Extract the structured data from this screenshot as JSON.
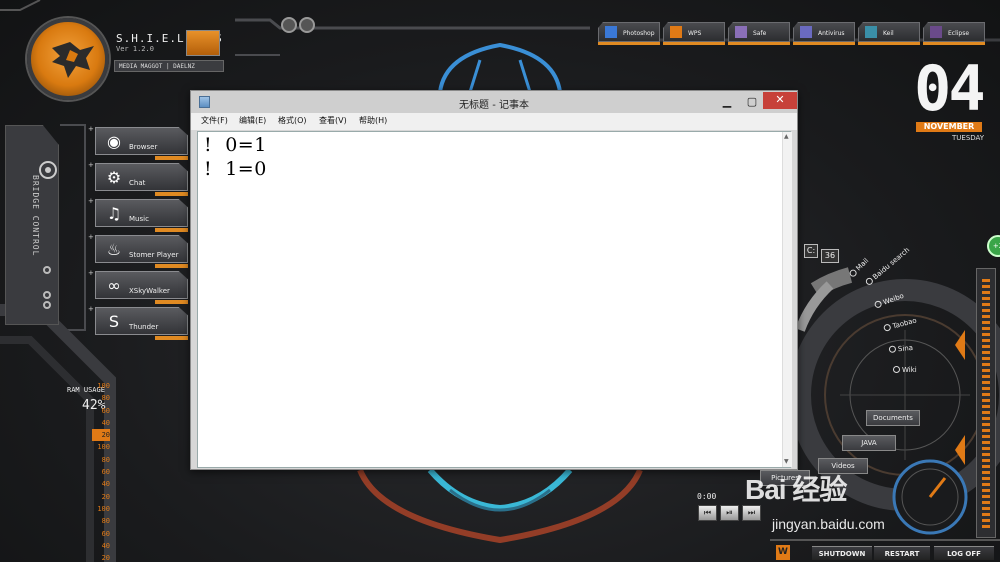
{
  "os_panel": {
    "title": "S.H.I.E.L.D OS",
    "version": "Ver 1.2.0",
    "credit": "MEDIA MAGGOT | DAELNZ"
  },
  "dock": {
    "items": [
      {
        "label": "Photoshop",
        "icon": "photoshop-icon",
        "color": "#3a78d6"
      },
      {
        "label": "WPS",
        "icon": "wps-icon",
        "color": "#e07a16"
      },
      {
        "label": "Safe",
        "icon": "safe-icon",
        "color": "#8a6fb8"
      },
      {
        "label": "Antivirus",
        "icon": "antivirus-icon",
        "color": "#6a6ac0"
      },
      {
        "label": "Keil",
        "icon": "keil-icon",
        "color": "#3a8fa8"
      },
      {
        "label": "Eclipse",
        "icon": "eclipse-icon",
        "color": "#6a4a8a"
      }
    ]
  },
  "clock": {
    "day": "04",
    "month": "NOVEMBER",
    "weekday": "TUESDAY"
  },
  "launcher": {
    "items": [
      {
        "label": "Browser",
        "icon": "chrome-icon",
        "glyph": "◉"
      },
      {
        "label": "Chat",
        "icon": "steam-icon",
        "glyph": "⚙"
      },
      {
        "label": "Music",
        "icon": "music-note-icon",
        "glyph": "♫"
      },
      {
        "label": "Stomer Player",
        "icon": "fire-icon",
        "glyph": "♨"
      },
      {
        "label": "XSkyWalker",
        "icon": "infinity-icon",
        "glyph": "∞"
      },
      {
        "label": "Thunder",
        "icon": "skype-icon",
        "glyph": "S"
      }
    ]
  },
  "bridge_control": "BRIDGE CONTROL",
  "ram": {
    "label": "RAM USAGE",
    "value": "42%",
    "ticks": [
      "100",
      "80",
      "60",
      "40",
      "20",
      "100",
      "80",
      "60",
      "40",
      "20",
      "100",
      "80",
      "60",
      "40",
      "20"
    ]
  },
  "notepad": {
    "title": "无标题 - 记事本",
    "menu": [
      "文件(F)",
      "编辑(E)",
      "格式(O)",
      "查看(V)",
      "帮助(H)"
    ],
    "lines": [
      "!  0=1",
      "!  1=0"
    ]
  },
  "drive": {
    "letter": "C:",
    "count": "36"
  },
  "radial_links": [
    "Mail",
    "Baidu search",
    "Weibo",
    "Taobao",
    "Sina",
    "Wiki"
  ],
  "chips": {
    "documents": "Documents",
    "java": "JAVA",
    "pictures": "Pictures",
    "videos": "Videos"
  },
  "media": {
    "time": "0:00",
    "prev": "⏮",
    "play": "⏯",
    "next": "⏭"
  },
  "power": {
    "shutdown": "SHUTDOWN",
    "restart": "RESTART",
    "logoff": "LOG OFF",
    "w_glyph": "W"
  },
  "net_badge": "+2",
  "watermark": {
    "logo": "Bai 经验",
    "url": "jingyan.baidu.com"
  }
}
